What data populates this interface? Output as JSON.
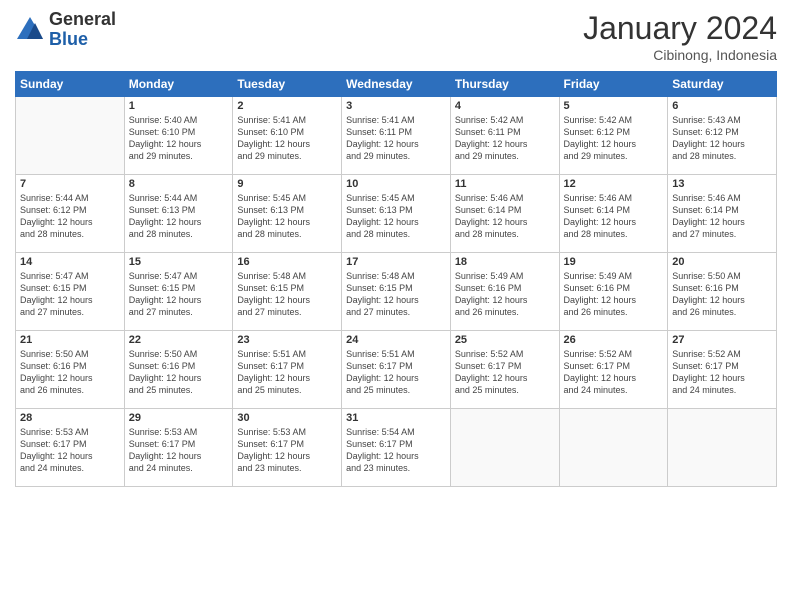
{
  "header": {
    "logo_general": "General",
    "logo_blue": "Blue",
    "month_year": "January 2024",
    "location": "Cibinong, Indonesia"
  },
  "days_of_week": [
    "Sunday",
    "Monday",
    "Tuesday",
    "Wednesday",
    "Thursday",
    "Friday",
    "Saturday"
  ],
  "weeks": [
    [
      {
        "day": "",
        "info": ""
      },
      {
        "day": "1",
        "info": "Sunrise: 5:40 AM\nSunset: 6:10 PM\nDaylight: 12 hours\nand 29 minutes."
      },
      {
        "day": "2",
        "info": "Sunrise: 5:41 AM\nSunset: 6:10 PM\nDaylight: 12 hours\nand 29 minutes."
      },
      {
        "day": "3",
        "info": "Sunrise: 5:41 AM\nSunset: 6:11 PM\nDaylight: 12 hours\nand 29 minutes."
      },
      {
        "day": "4",
        "info": "Sunrise: 5:42 AM\nSunset: 6:11 PM\nDaylight: 12 hours\nand 29 minutes."
      },
      {
        "day": "5",
        "info": "Sunrise: 5:42 AM\nSunset: 6:12 PM\nDaylight: 12 hours\nand 29 minutes."
      },
      {
        "day": "6",
        "info": "Sunrise: 5:43 AM\nSunset: 6:12 PM\nDaylight: 12 hours\nand 28 minutes."
      }
    ],
    [
      {
        "day": "7",
        "info": "Sunrise: 5:44 AM\nSunset: 6:12 PM\nDaylight: 12 hours\nand 28 minutes."
      },
      {
        "day": "8",
        "info": "Sunrise: 5:44 AM\nSunset: 6:13 PM\nDaylight: 12 hours\nand 28 minutes."
      },
      {
        "day": "9",
        "info": "Sunrise: 5:45 AM\nSunset: 6:13 PM\nDaylight: 12 hours\nand 28 minutes."
      },
      {
        "day": "10",
        "info": "Sunrise: 5:45 AM\nSunset: 6:13 PM\nDaylight: 12 hours\nand 28 minutes."
      },
      {
        "day": "11",
        "info": "Sunrise: 5:46 AM\nSunset: 6:14 PM\nDaylight: 12 hours\nand 28 minutes."
      },
      {
        "day": "12",
        "info": "Sunrise: 5:46 AM\nSunset: 6:14 PM\nDaylight: 12 hours\nand 28 minutes."
      },
      {
        "day": "13",
        "info": "Sunrise: 5:46 AM\nSunset: 6:14 PM\nDaylight: 12 hours\nand 27 minutes."
      }
    ],
    [
      {
        "day": "14",
        "info": "Sunrise: 5:47 AM\nSunset: 6:15 PM\nDaylight: 12 hours\nand 27 minutes."
      },
      {
        "day": "15",
        "info": "Sunrise: 5:47 AM\nSunset: 6:15 PM\nDaylight: 12 hours\nand 27 minutes."
      },
      {
        "day": "16",
        "info": "Sunrise: 5:48 AM\nSunset: 6:15 PM\nDaylight: 12 hours\nand 27 minutes."
      },
      {
        "day": "17",
        "info": "Sunrise: 5:48 AM\nSunset: 6:15 PM\nDaylight: 12 hours\nand 27 minutes."
      },
      {
        "day": "18",
        "info": "Sunrise: 5:49 AM\nSunset: 6:16 PM\nDaylight: 12 hours\nand 26 minutes."
      },
      {
        "day": "19",
        "info": "Sunrise: 5:49 AM\nSunset: 6:16 PM\nDaylight: 12 hours\nand 26 minutes."
      },
      {
        "day": "20",
        "info": "Sunrise: 5:50 AM\nSunset: 6:16 PM\nDaylight: 12 hours\nand 26 minutes."
      }
    ],
    [
      {
        "day": "21",
        "info": "Sunrise: 5:50 AM\nSunset: 6:16 PM\nDaylight: 12 hours\nand 26 minutes."
      },
      {
        "day": "22",
        "info": "Sunrise: 5:50 AM\nSunset: 6:16 PM\nDaylight: 12 hours\nand 25 minutes."
      },
      {
        "day": "23",
        "info": "Sunrise: 5:51 AM\nSunset: 6:17 PM\nDaylight: 12 hours\nand 25 minutes."
      },
      {
        "day": "24",
        "info": "Sunrise: 5:51 AM\nSunset: 6:17 PM\nDaylight: 12 hours\nand 25 minutes."
      },
      {
        "day": "25",
        "info": "Sunrise: 5:52 AM\nSunset: 6:17 PM\nDaylight: 12 hours\nand 25 minutes."
      },
      {
        "day": "26",
        "info": "Sunrise: 5:52 AM\nSunset: 6:17 PM\nDaylight: 12 hours\nand 24 minutes."
      },
      {
        "day": "27",
        "info": "Sunrise: 5:52 AM\nSunset: 6:17 PM\nDaylight: 12 hours\nand 24 minutes."
      }
    ],
    [
      {
        "day": "28",
        "info": "Sunrise: 5:53 AM\nSunset: 6:17 PM\nDaylight: 12 hours\nand 24 minutes."
      },
      {
        "day": "29",
        "info": "Sunrise: 5:53 AM\nSunset: 6:17 PM\nDaylight: 12 hours\nand 24 minutes."
      },
      {
        "day": "30",
        "info": "Sunrise: 5:53 AM\nSunset: 6:17 PM\nDaylight: 12 hours\nand 23 minutes."
      },
      {
        "day": "31",
        "info": "Sunrise: 5:54 AM\nSunset: 6:17 PM\nDaylight: 12 hours\nand 23 minutes."
      },
      {
        "day": "",
        "info": ""
      },
      {
        "day": "",
        "info": ""
      },
      {
        "day": "",
        "info": ""
      }
    ]
  ]
}
